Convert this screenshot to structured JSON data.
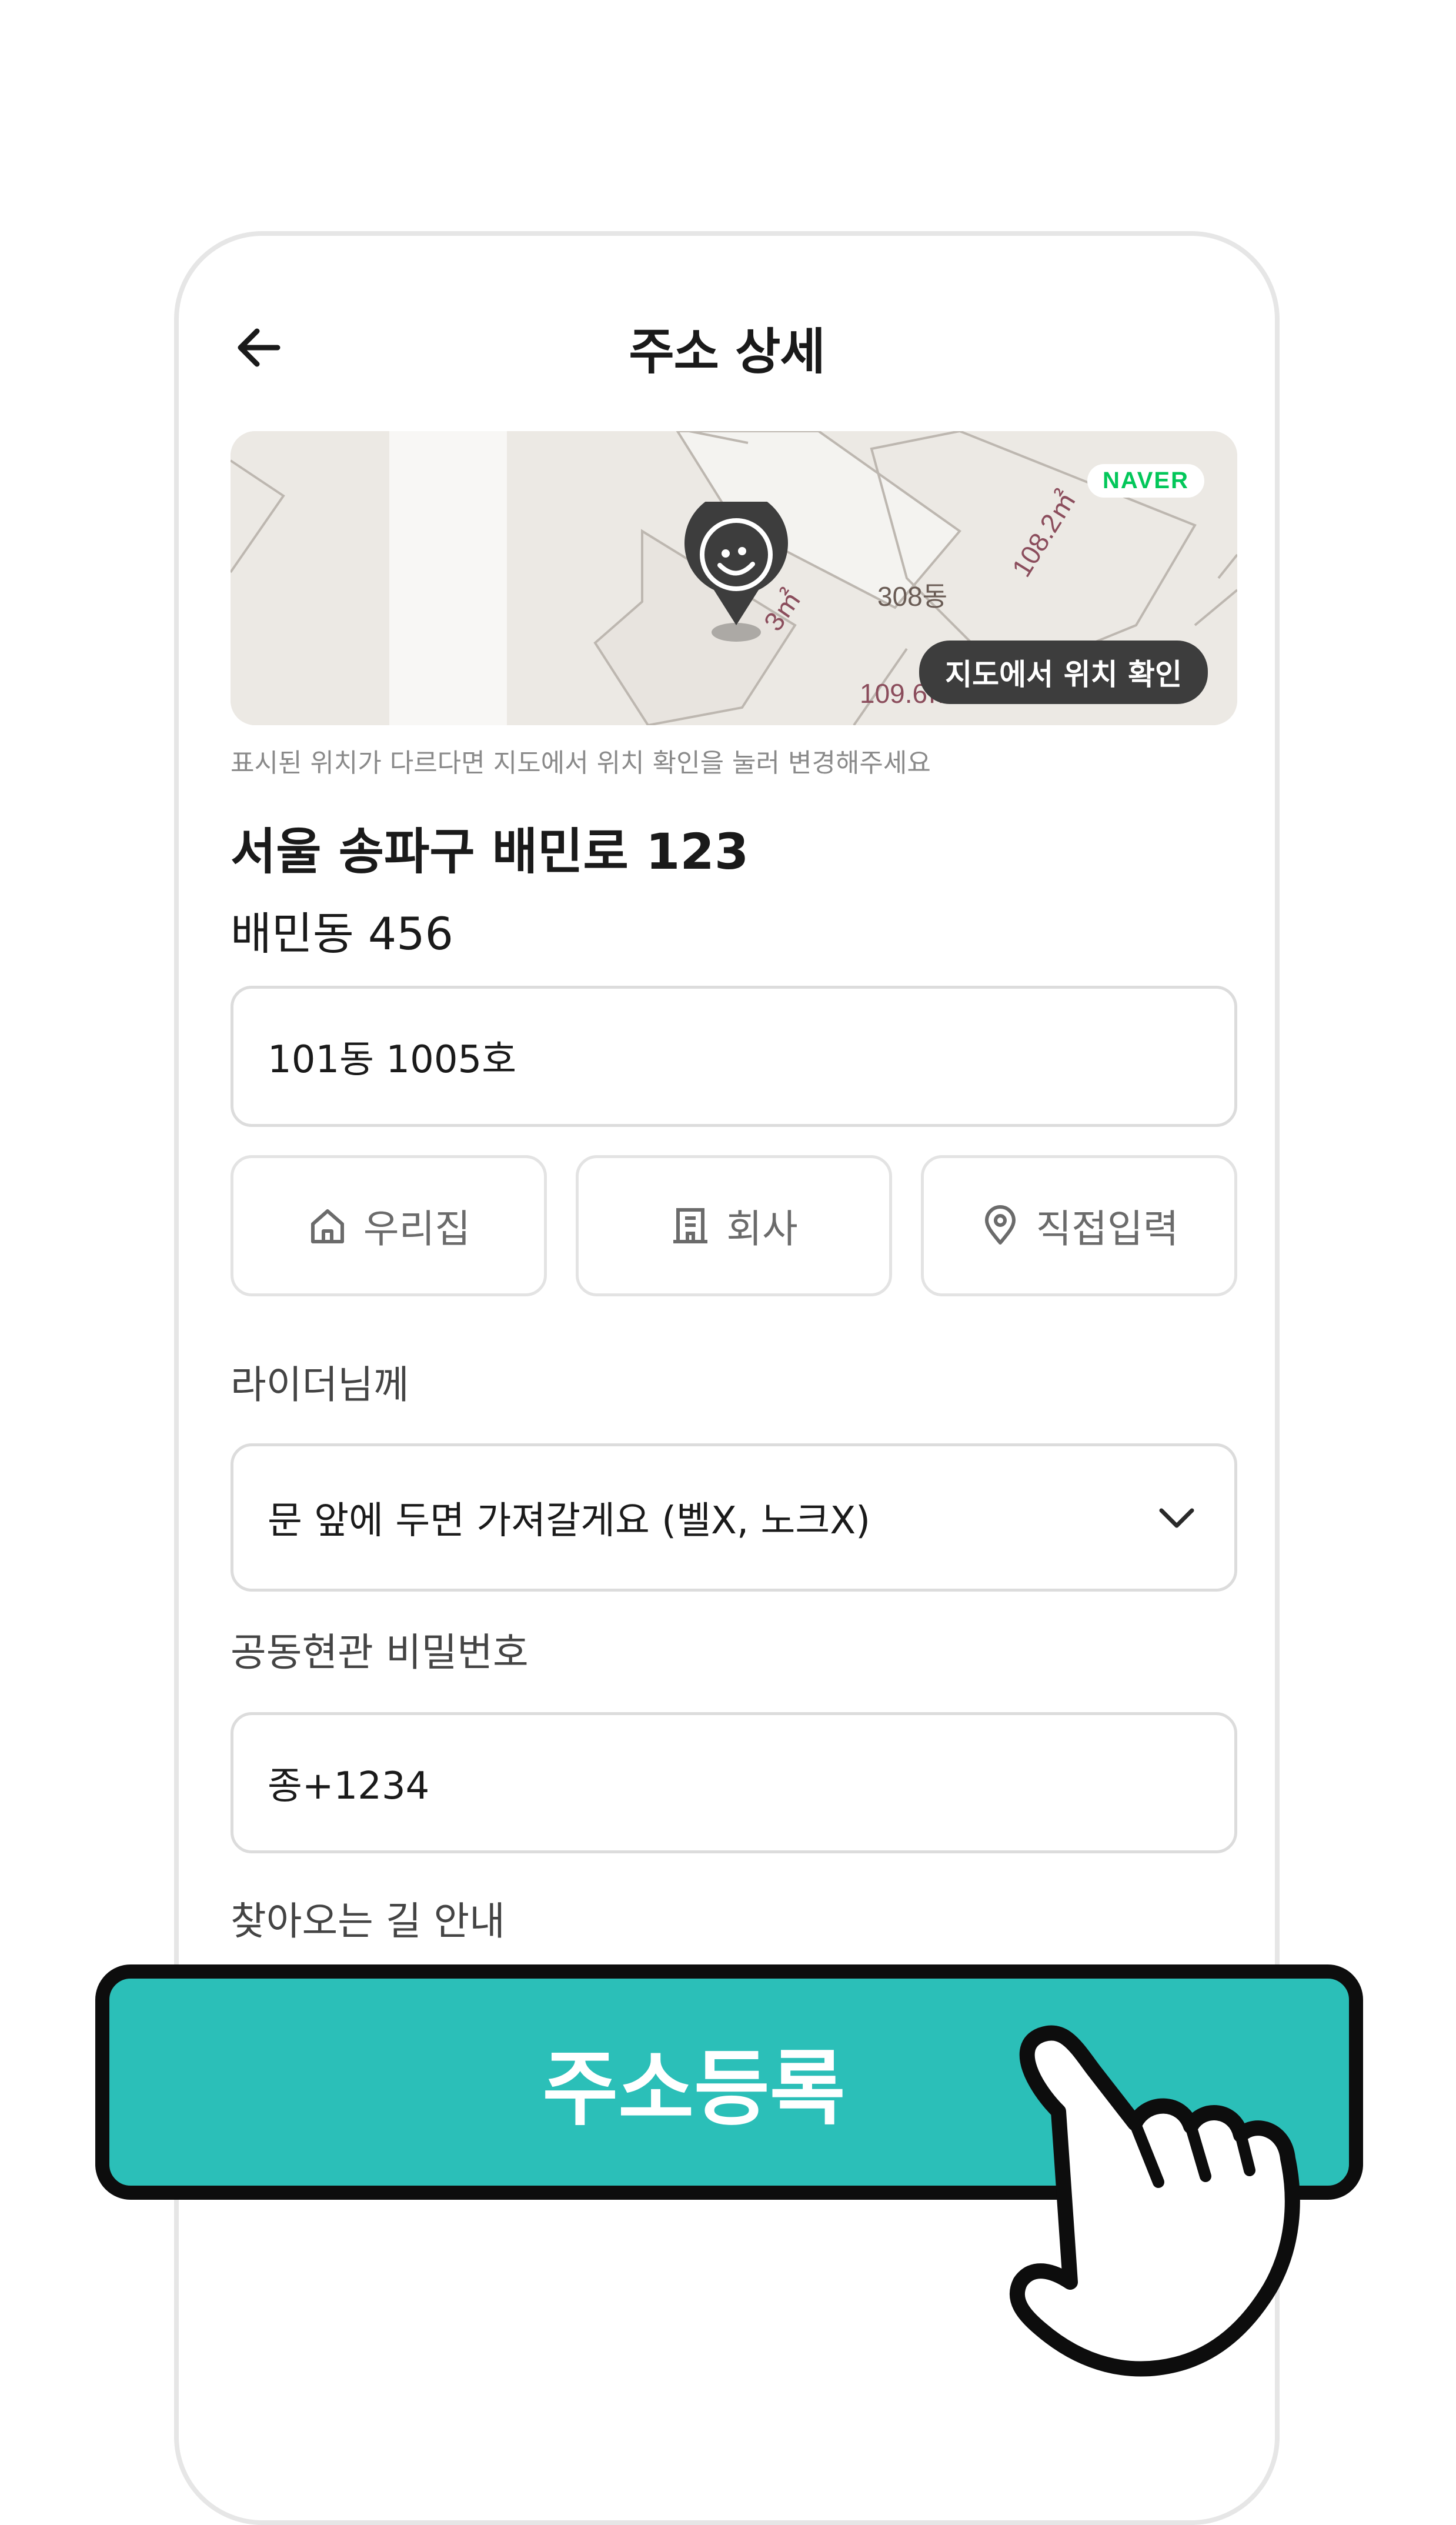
{
  "header": {
    "title": "주소 상세"
  },
  "map": {
    "brand": "NAVER",
    "confirm_button": "지도에서 위치 확인",
    "labels": {
      "building": "308동",
      "area_top": "108.2㎡",
      "area_bottom": "109.6㎡",
      "unit_fragment": "3㎡"
    }
  },
  "hint": "표시된 위치가 다르다면 지도에서 위치 확인을 눌러 변경해주세요",
  "address": {
    "road": "서울 송파구 배민로 123",
    "jibun": "배민동 456"
  },
  "detail_input": {
    "value": "101동 1005호"
  },
  "address_types": [
    {
      "label": "우리집",
      "icon": "home-icon"
    },
    {
      "label": "회사",
      "icon": "building-icon"
    },
    {
      "label": "직접입력",
      "icon": "location-pin-icon"
    }
  ],
  "rider_request": {
    "label": "라이더님께",
    "selected": "문 앞에 두면 가져갈게요 (벨X, 노크X)"
  },
  "entrance_password": {
    "label": "공동현관 비밀번호",
    "value": "종+1234"
  },
  "directions": {
    "label": "찾아오는 길 안내"
  },
  "cta": {
    "label": "주소등록"
  },
  "colors": {
    "accent": "#2bbfb8",
    "naver": "#03c75a",
    "map_bg": "#ece9e4",
    "pin": "#3d3d3d"
  }
}
